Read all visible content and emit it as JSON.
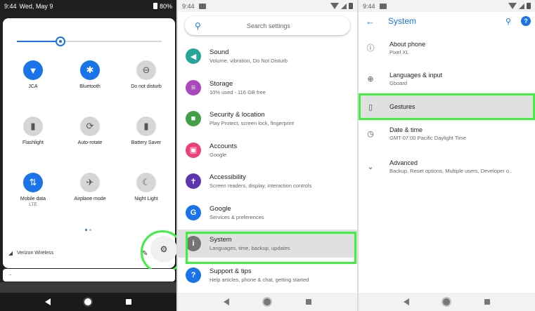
{
  "quick_settings": {
    "status": {
      "time": "9:44",
      "date": "Wed, May 9",
      "battery": "80%"
    },
    "brightness_level": 0.3,
    "tiles": [
      {
        "label": "JCA",
        "sub": "",
        "icon": "wifi-icon",
        "glyph": "▼",
        "on": true
      },
      {
        "label": "Bluetooth",
        "sub": "",
        "icon": "bluetooth-icon",
        "glyph": "✱",
        "on": true
      },
      {
        "label": "Do not disturb",
        "sub": "",
        "icon": "do-not-disturb-icon",
        "glyph": "⊖",
        "on": false
      },
      {
        "label": "Flashlight",
        "sub": "",
        "icon": "flashlight-icon",
        "glyph": "▮",
        "on": false
      },
      {
        "label": "Auto-rotate",
        "sub": "",
        "icon": "auto-rotate-icon",
        "glyph": "⟳",
        "on": false
      },
      {
        "label": "Battery Saver",
        "sub": "",
        "icon": "battery-saver-icon",
        "glyph": "▮",
        "on": false
      },
      {
        "label": "Mobile data",
        "sub": "LTE",
        "icon": "mobile-data-icon",
        "glyph": "⇅",
        "on": true
      },
      {
        "label": "Airplane mode",
        "sub": "",
        "icon": "airplane-icon",
        "glyph": "✈",
        "on": false
      },
      {
        "label": "Night Light",
        "sub": "",
        "icon": "night-light-icon",
        "glyph": "☾",
        "on": false
      }
    ],
    "carrier": "Verizon Wireless",
    "notification_text": ".."
  },
  "settings": {
    "status": {
      "time": "9:44"
    },
    "search_placeholder": "Search settings",
    "items": [
      {
        "title": "Sound",
        "subtitle": "Volume, vibration, Do Not Disturb",
        "icon": "sound-icon",
        "glyph": "◀",
        "color": "#26a69a"
      },
      {
        "title": "Storage",
        "subtitle": "10% used - 116 GB free",
        "icon": "storage-icon",
        "glyph": "≡",
        "color": "#ab47bc"
      },
      {
        "title": "Security & location",
        "subtitle": "Play Protect, screen lock, fingerprint",
        "icon": "lock-icon",
        "glyph": "■",
        "color": "#43a047"
      },
      {
        "title": "Accounts",
        "subtitle": "Google",
        "icon": "accounts-icon",
        "glyph": "▣",
        "color": "#ec407a"
      },
      {
        "title": "Accessibility",
        "subtitle": "Screen readers, display, interaction controls",
        "icon": "accessibility-icon",
        "glyph": "✝",
        "color": "#5e35b1"
      },
      {
        "title": "Google",
        "subtitle": "Services & preferences",
        "icon": "google-icon",
        "glyph": "G",
        "color": "#1a73e8"
      },
      {
        "title": "System",
        "subtitle": "Languages, time, backup, updates",
        "icon": "system-info-icon",
        "glyph": "i",
        "color": "#757575",
        "highlighted": true
      },
      {
        "title": "Support & tips",
        "subtitle": "Help articles, phone & chat, getting started",
        "icon": "help-icon",
        "glyph": "?",
        "color": "#1a73e8"
      }
    ]
  },
  "system": {
    "status": {
      "time": "9:44"
    },
    "title": "System",
    "items": [
      {
        "title": "About phone",
        "subtitle": "Pixel XL",
        "icon": "info-icon",
        "glyph": "ⓘ"
      },
      {
        "title": "Languages & input",
        "subtitle": "Gboard",
        "icon": "globe-icon",
        "glyph": "⊕"
      },
      {
        "title": "Gestures",
        "subtitle": "",
        "icon": "gestures-icon",
        "glyph": "▯",
        "highlighted": true
      },
      {
        "title": "Date & time",
        "subtitle": "GMT-07:00 Pacific Daylight Time",
        "icon": "clock-icon",
        "glyph": "◷"
      },
      {
        "title": "Advanced",
        "subtitle": "Backup, Reset options, Multiple users, Developer o..",
        "icon": "chevron-down-icon",
        "glyph": "⌄"
      }
    ]
  },
  "colors": {
    "accent": "#1a73e8",
    "highlight_outline": "#3ff03f"
  }
}
